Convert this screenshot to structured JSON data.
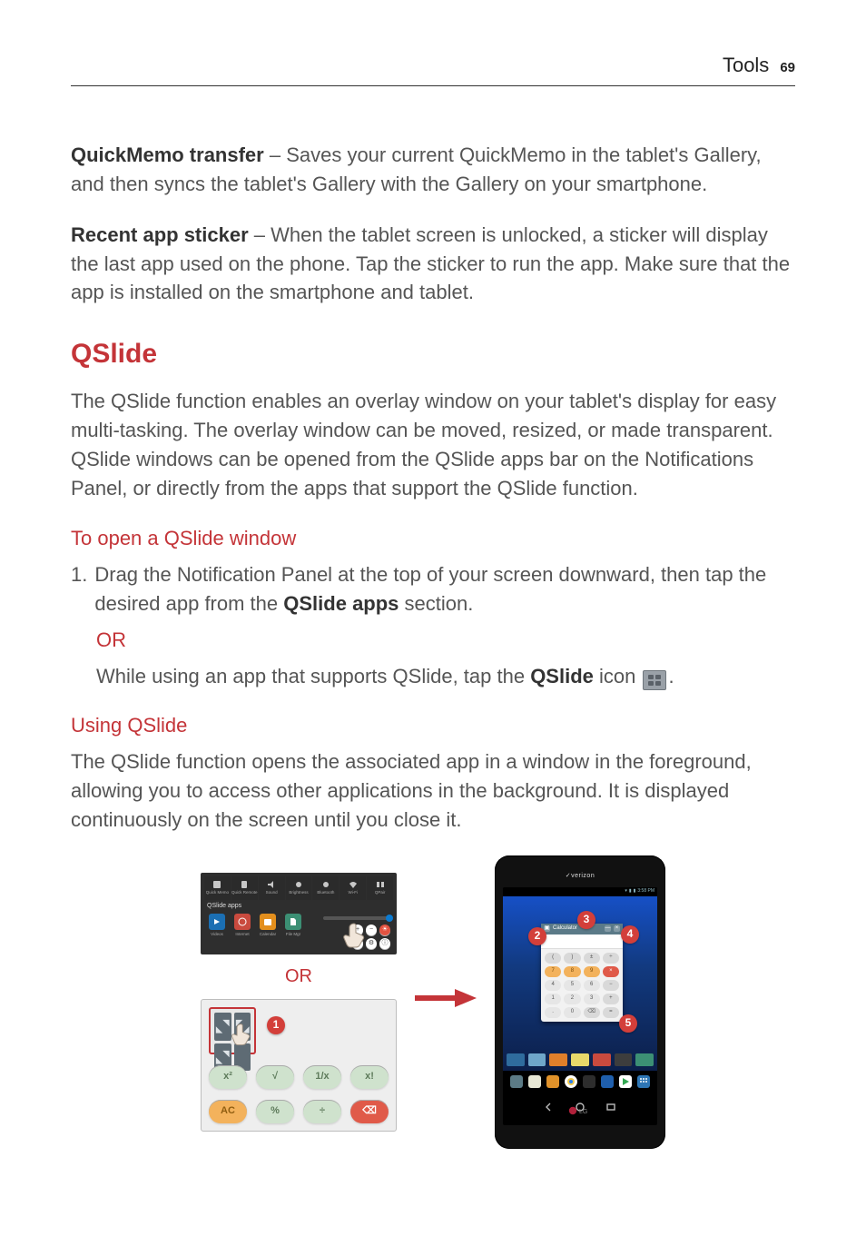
{
  "header": {
    "section": "Tools",
    "page_number": "69"
  },
  "body": {
    "quickmemo": {
      "term": "QuickMemo transfer",
      "desc": " – Saves your current QuickMemo in the tablet's Gallery, and then syncs the tablet's Gallery with the Gallery on your smartphone."
    },
    "recent_sticker": {
      "term": "Recent app sticker",
      "desc": " – When the tablet screen is unlocked, a sticker will display the last app used on the phone. Tap the sticker to run the app. Make sure that the app is installed on the smartphone and tablet."
    },
    "qslide_heading": "QSlide",
    "qslide_intro": "The QSlide function enables an overlay window on your tablet's display for easy multi-tasking. The overlay window can be moved, resized, or made transparent. QSlide windows can be opened from the QSlide apps bar on the Notifications Panel, or directly from the apps that support the QSlide function.",
    "open_heading": "To open a QSlide window",
    "step_num": "1.",
    "step_text_a": "Drag the Notification Panel at the top of your screen downward, then tap the desired app from the ",
    "step_bold_a": "QSlide apps",
    "step_text_b": " section.",
    "or": "OR",
    "step_alt_a": "While using an app that supports QSlide, tap the ",
    "step_alt_bold": "QSlide",
    "step_alt_b": " icon ",
    "step_alt_c": ".",
    "using_heading": "Using QSlide",
    "using_para": "The QSlide function opens the associated app in a window in the foreground, allowing you to access other applications in the background. It is displayed continuously on the screen until you close it."
  },
  "figures": {
    "or_label": "OR",
    "callouts": {
      "1": "1",
      "2": "2",
      "3": "3",
      "4": "4",
      "5": "5"
    },
    "np_tiles": [
      {
        "name": "quickmemo-icon",
        "label": "Quick Memo"
      },
      {
        "name": "quickremote-icon",
        "label": "Quick Remote"
      },
      {
        "name": "sound-icon",
        "label": "Sound"
      },
      {
        "name": "brightness-icon",
        "label": "Brightness"
      },
      {
        "name": "bluetooth-icon",
        "label": "Bluetooth"
      },
      {
        "name": "wifi-icon",
        "label": "Wi-Fi"
      },
      {
        "name": "qpair-icon",
        "label": "QPair"
      }
    ],
    "np_qslabel": "QSlide apps",
    "np_qsapps": [
      {
        "name": "video-icon",
        "label": "Videos",
        "bg": "#1b6fb3"
      },
      {
        "name": "internet-icon",
        "label": "Internet",
        "bg": "#c94a3e"
      },
      {
        "name": "calendar-icon",
        "label": "Calendar",
        "bg": "#e38f1d"
      },
      {
        "name": "filemgr-icon",
        "label": "File Mgr",
        "bg": "#3c8f74"
      }
    ],
    "calc_keys_row1": [
      "x²",
      "√",
      "1/x",
      "x!"
    ],
    "calc_keys_row2": [
      "AC",
      "%",
      "÷",
      "⌫"
    ],
    "tablet": {
      "carrier": "verizon",
      "status": "3:58 PM",
      "qs_title": "Calculator",
      "keys": [
        "(",
        ")",
        "±",
        "÷",
        "7",
        "8",
        "9",
        "×",
        "4",
        "5",
        "6",
        "−",
        "1",
        "2",
        "3",
        "+",
        ".",
        "0",
        "⌫",
        "="
      ],
      "dock": [
        {
          "name": "browser-icon",
          "bg": "#5c7b86"
        },
        {
          "name": "calendar-icon",
          "bg": "#e7e7d5"
        },
        {
          "name": "email-icon",
          "bg": "#e0922a"
        },
        {
          "name": "chrome-icon",
          "bg": "#fff"
        },
        {
          "name": "camera-icon",
          "bg": "#2d2d2d"
        },
        {
          "name": "gallery-icon",
          "bg": "#1f5fad"
        },
        {
          "name": "playstore-icon",
          "bg": "#fff"
        },
        {
          "name": "apps-icon",
          "bg": "#2e76b5"
        }
      ],
      "lg": "LG"
    }
  }
}
